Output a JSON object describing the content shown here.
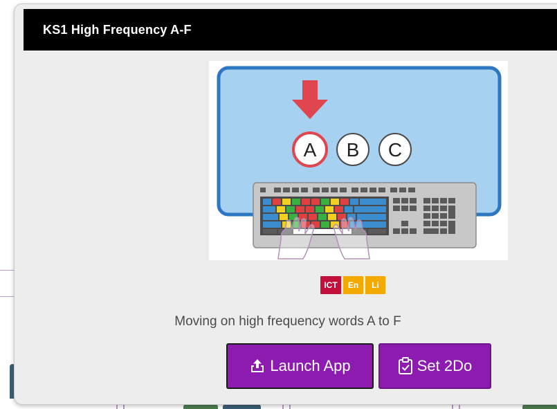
{
  "modal": {
    "title": "KS1 High Frequency A-F",
    "description": "Moving on high frequency words A to F",
    "illustration": {
      "letters": [
        "A",
        "B",
        "C"
      ]
    },
    "badges": [
      {
        "label": "ICT",
        "color": "#c2103c"
      },
      {
        "label": "En",
        "color": "#f2a900"
      },
      {
        "label": "Li",
        "color": "#f2a900"
      }
    ],
    "buttons": {
      "launch_label": "Launch App",
      "set2do_label": "Set 2Do"
    }
  },
  "colors": {
    "header_bg": "#000000",
    "button_bg": "#8e1bb0",
    "modal_bg": "#ededed",
    "screen_blue": "#a6d1f0",
    "arrow_red": "#e0464f"
  }
}
